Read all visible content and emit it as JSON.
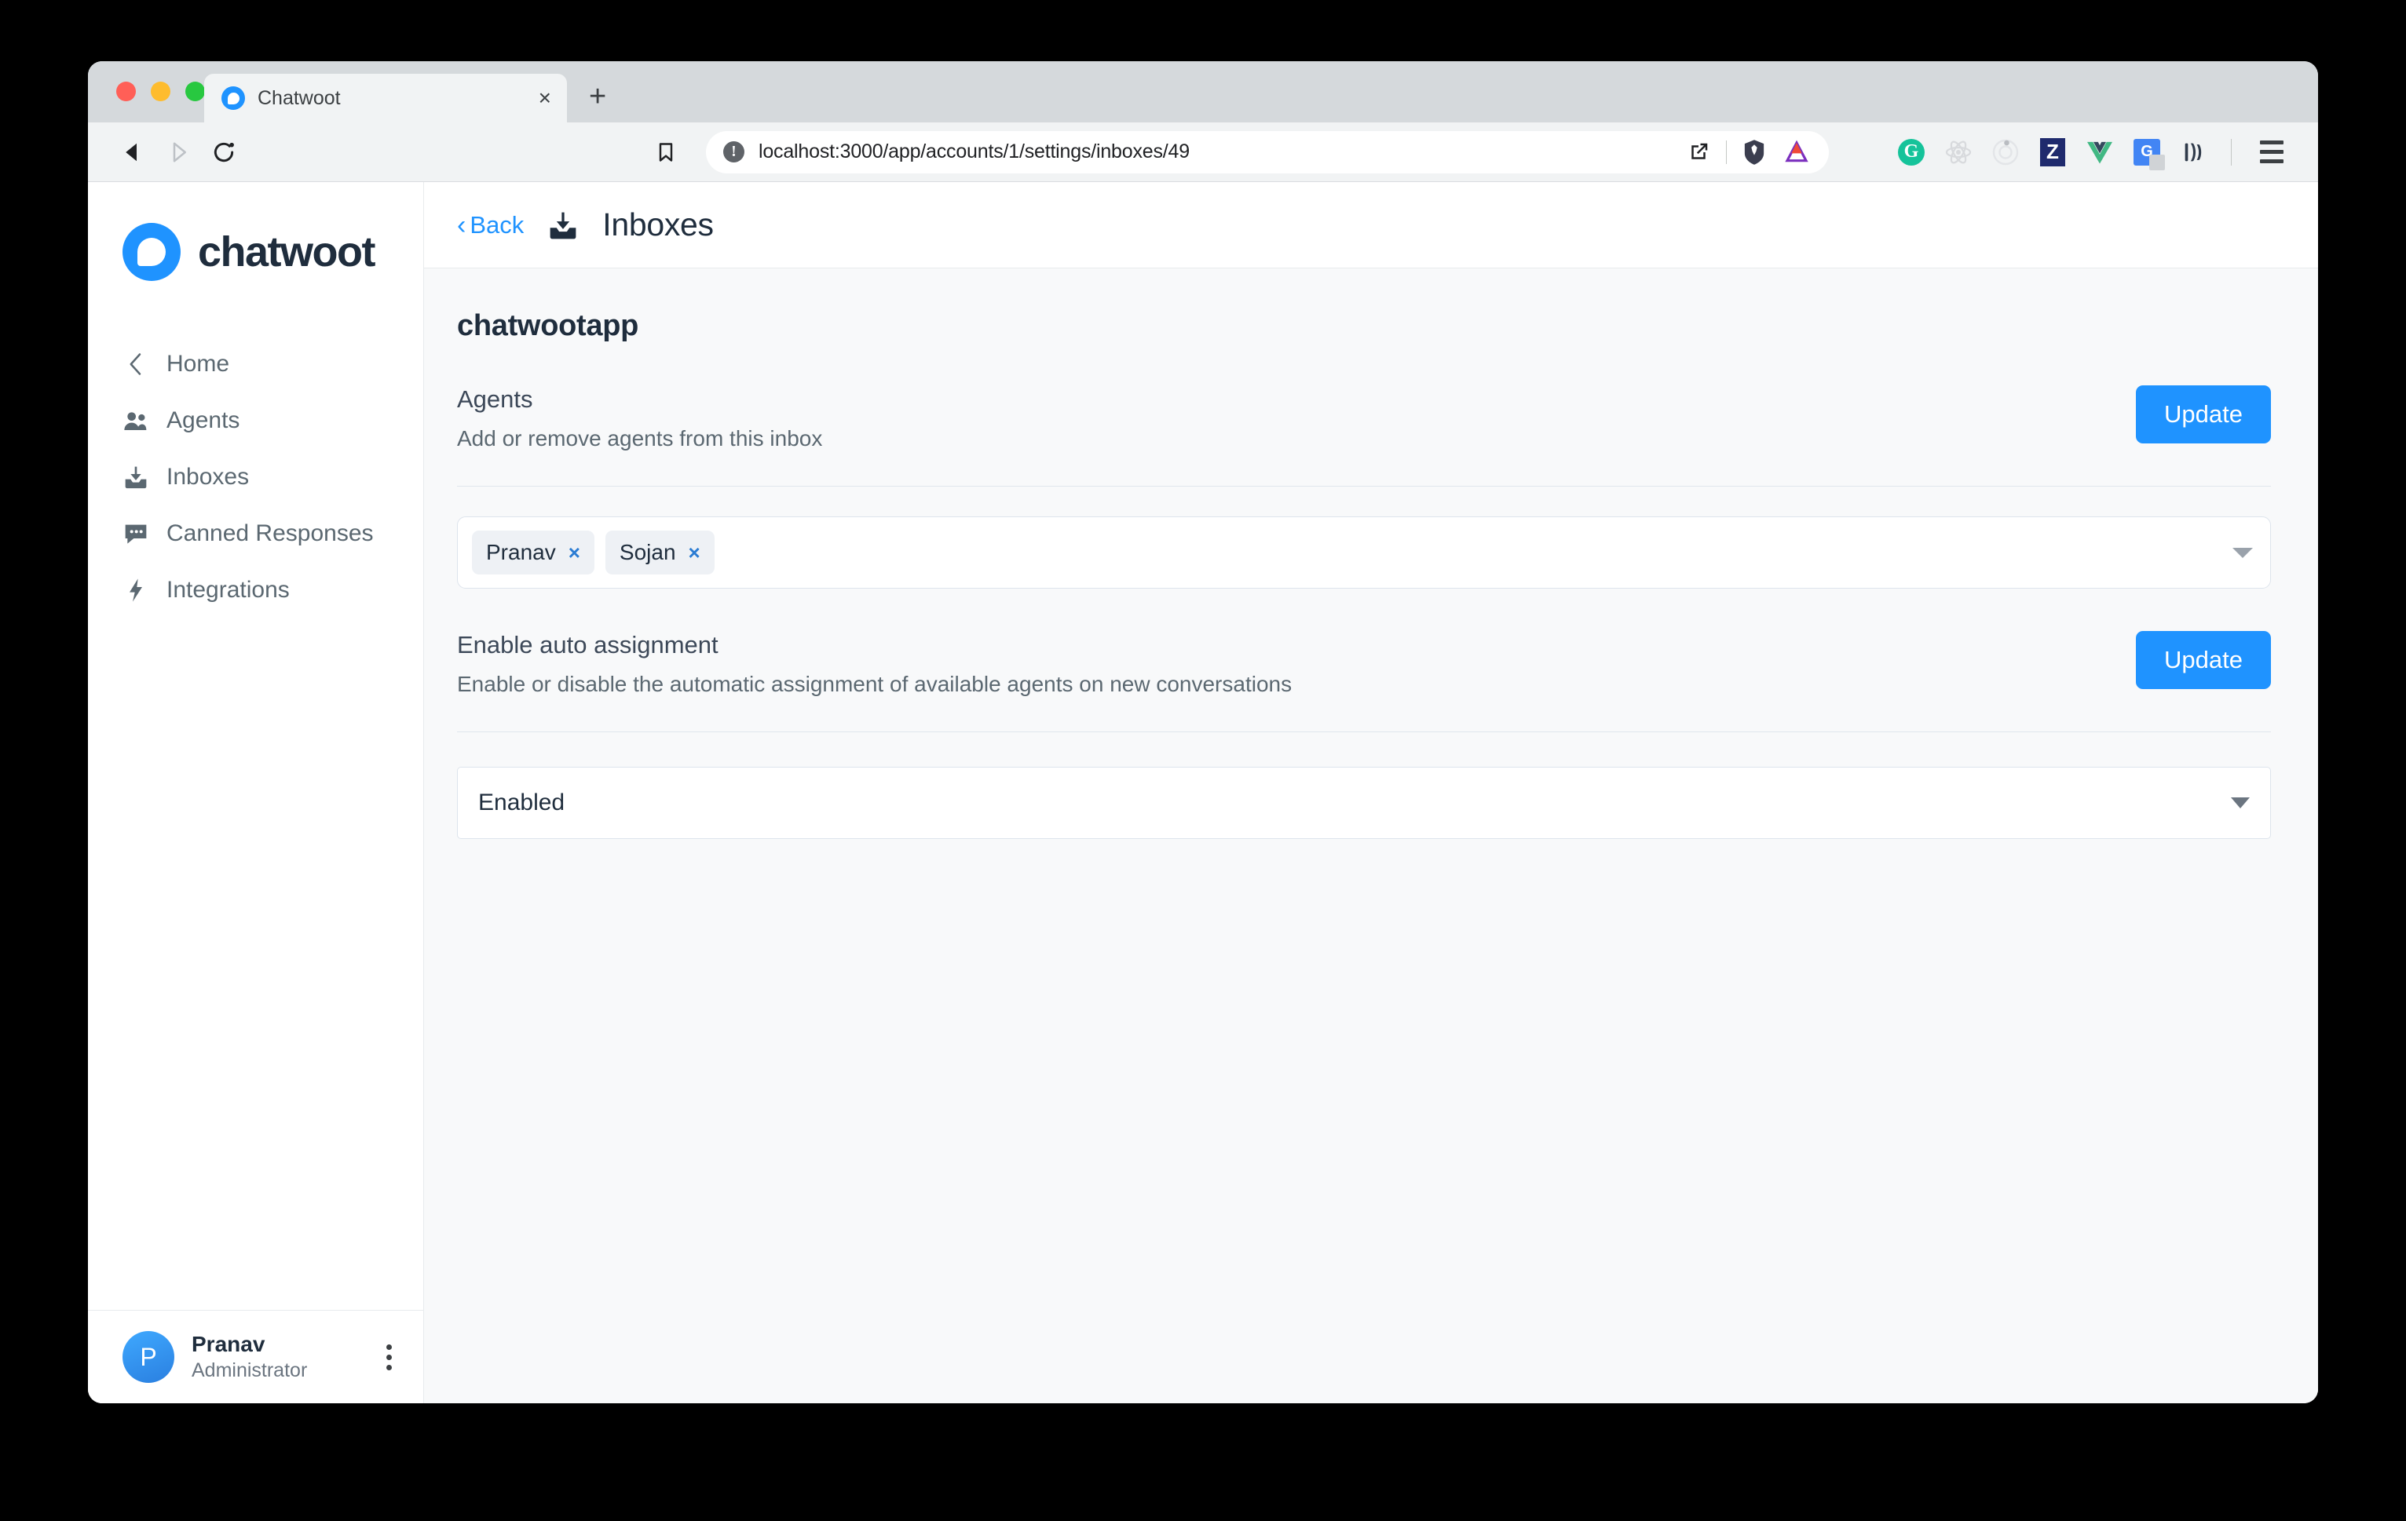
{
  "browser": {
    "tab": {
      "title": "Chatwoot",
      "favicon": "chatwoot-logo-icon",
      "close_label": "×"
    },
    "new_tab_label": "+",
    "url": "localhost:3000/app/accounts/1/settings/inboxes/49",
    "url_info_icon": "!",
    "nav": {
      "back_icon": "back-arrow-icon",
      "forward_icon": "forward-arrow-icon",
      "reload_icon": "reload-icon",
      "bookmark_icon": "bookmark-icon"
    },
    "url_actions": {
      "open_external_icon": "open-external-icon",
      "brave_shield_icon": "brave-shields-icon",
      "brave_rewards_icon": "brave-rewards-icon"
    },
    "extensions": [
      {
        "name": "grammarly",
        "label": "G"
      },
      {
        "name": "react-devtools",
        "label": ""
      },
      {
        "name": "redux-devtools",
        "label": ""
      },
      {
        "name": "zotero",
        "label": "Z"
      },
      {
        "name": "vue-devtools",
        "label": ""
      },
      {
        "name": "google-translate",
        "label": "G"
      },
      {
        "name": "bitwarden",
        "label": ""
      }
    ],
    "menu_icon": "hamburger-menu-icon",
    "accent_blue": "#1f93ff"
  },
  "sidebar": {
    "brand": {
      "name": "chatwoot",
      "logo_icon": "chatwoot-logo-icon"
    },
    "items": [
      {
        "label": "Home",
        "icon": "chevron-left-icon"
      },
      {
        "label": "Agents",
        "icon": "users-icon"
      },
      {
        "label": "Inboxes",
        "icon": "inbox-tray-icon"
      },
      {
        "label": "Canned Responses",
        "icon": "chat-bubble-icon"
      },
      {
        "label": "Integrations",
        "icon": "lightning-bolt-icon"
      }
    ],
    "profile": {
      "initial": "P",
      "name": "Pranav",
      "role": "Administrator",
      "menu_icon": "vertical-dots-icon"
    }
  },
  "header": {
    "back_label": "Back",
    "back_chevron": "‹",
    "icon": "inbox-tray-icon",
    "title": "Inboxes"
  },
  "page": {
    "inbox_name": "chatwootapp",
    "agents_section": {
      "title": "Agents",
      "description": "Add or remove agents from this inbox",
      "update_label": "Update",
      "selected_agents": [
        {
          "name": "Pranav",
          "remove_label": "×"
        },
        {
          "name": "Sojan",
          "remove_label": "×"
        }
      ],
      "dropdown_icon": "caret-down-icon"
    },
    "auto_assignment_section": {
      "title": "Enable auto assignment",
      "description": "Enable or disable the automatic assignment of available agents on new conversations",
      "update_label": "Update",
      "selected_value": "Enabled",
      "dropdown_icon": "caret-down-icon"
    }
  }
}
